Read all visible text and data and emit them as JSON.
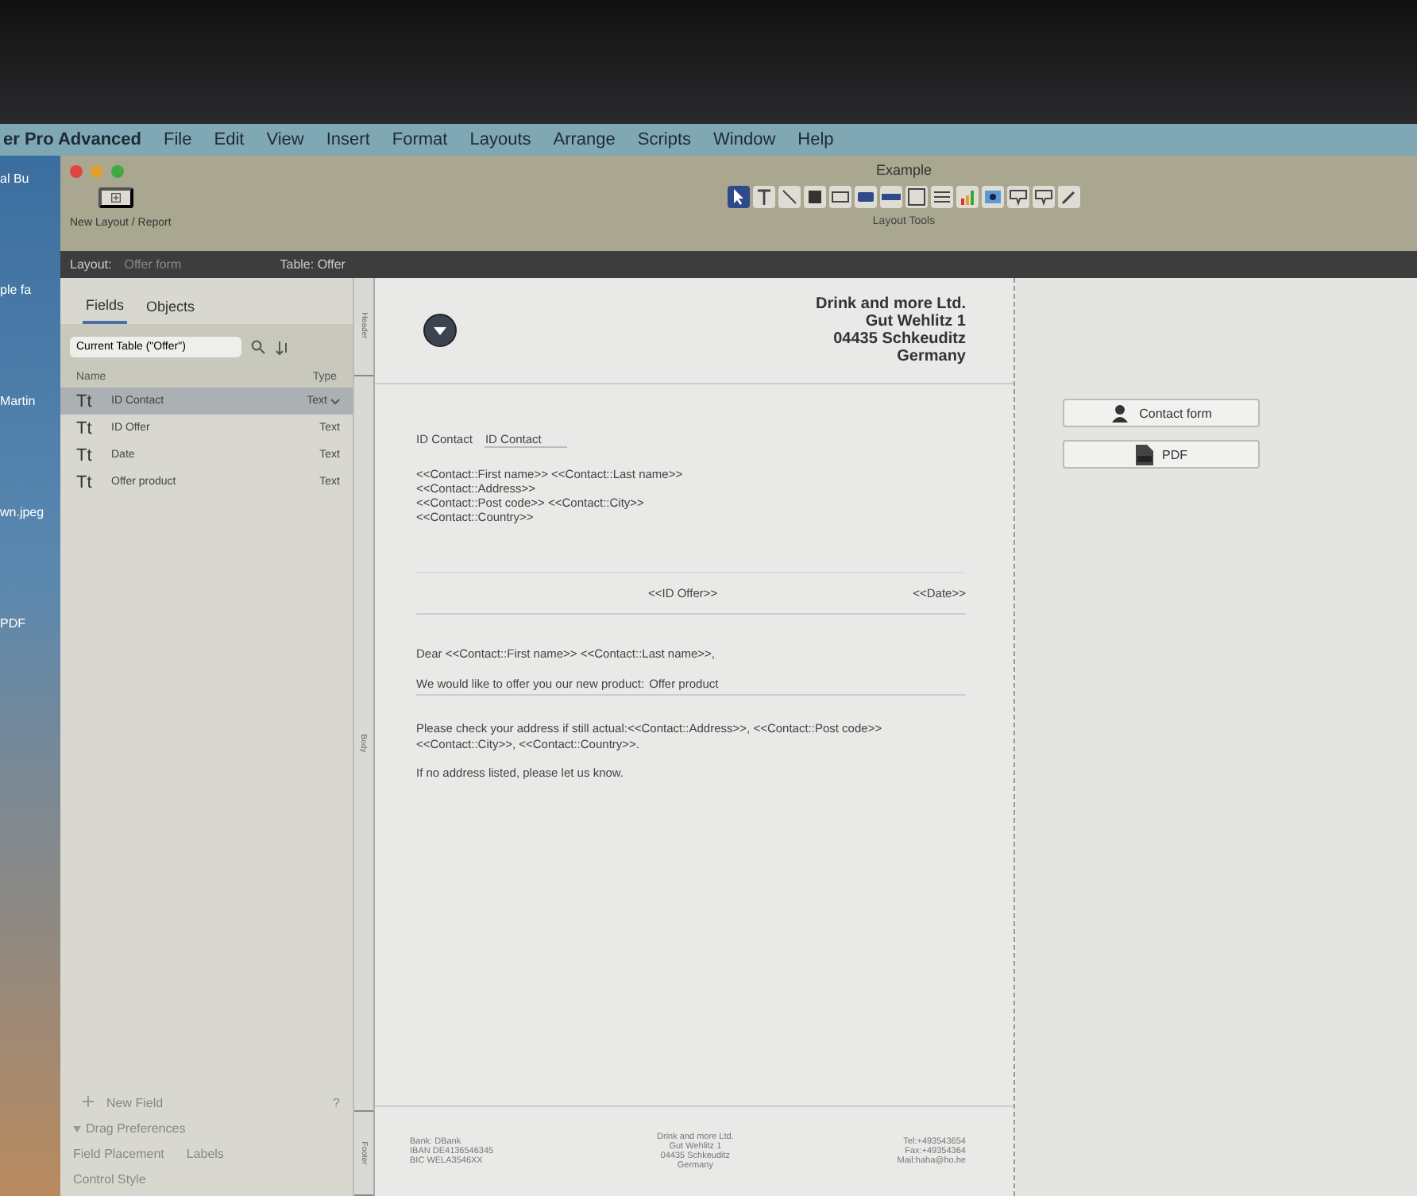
{
  "menu_bar": {
    "app_name": "er Pro Advanced",
    "items": [
      "File",
      "Edit",
      "View",
      "Insert",
      "Format",
      "Layouts",
      "Arrange",
      "Scripts",
      "Window",
      "Help"
    ]
  },
  "desktop": {
    "labels": [
      "al Bu",
      "ple fa",
      "Martin",
      "wn.jpeg",
      "PDF"
    ]
  },
  "window": {
    "title": "Example",
    "new_layout_label": "New Layout / Report",
    "tools_label": "Layout Tools",
    "tools": [
      {
        "kind": "pointer",
        "selected": true
      },
      {
        "kind": "text",
        "selected": false
      },
      {
        "kind": "line",
        "selected": false
      },
      {
        "kind": "shape",
        "selected": false
      },
      {
        "kind": "field",
        "selected": false
      },
      {
        "kind": "button",
        "selected": false
      },
      {
        "kind": "buttonbar",
        "selected": false
      },
      {
        "kind": "portal",
        "selected": false
      },
      {
        "kind": "list",
        "selected": false
      },
      {
        "kind": "chart",
        "selected": false
      },
      {
        "kind": "web",
        "selected": false
      },
      {
        "kind": "popover",
        "selected": false
      },
      {
        "kind": "popover",
        "selected": false
      },
      {
        "kind": "eyedropper",
        "selected": false
      }
    ]
  },
  "layout_bar": {
    "layout_label": "Layout:",
    "layout_value": "Offer form",
    "table": "Table: Offer"
  },
  "left_panel": {
    "tabs": [
      {
        "label": "Fields",
        "selected": true
      },
      {
        "label": "Objects",
        "selected": false
      }
    ],
    "table_select": "Current Table (\"Offer\")",
    "columns": [
      "Name",
      "Type"
    ],
    "fields": [
      {
        "icon": "Tt",
        "name": "ID Contact",
        "type": "Text",
        "selected": true
      },
      {
        "icon": "Tt",
        "name": "ID Offer",
        "type": "Text",
        "selected": false
      },
      {
        "icon": "Tt",
        "name": "Date",
        "type": "Text",
        "selected": false
      },
      {
        "icon": "Tt",
        "name": "Offer product",
        "type": "Text",
        "selected": false
      }
    ],
    "new_field": "New Field",
    "help": "?",
    "drag_preferences": "Drag Preferences",
    "field_placement": "Field Placement",
    "labels": "Labels",
    "control_style": "Control Style"
  },
  "parts": [
    "Header",
    "Body",
    "Footer"
  ],
  "page": {
    "company": [
      "Drink and more Ltd.",
      "Gut Wehlitz 1",
      "04435 Schkeuditz",
      "Germany"
    ],
    "id_label": "ID Contact",
    "id_field": "ID Contact",
    "address": [
      "<<Contact::First name>> <<Contact::Last name>>",
      "<<Contact::Address>>",
      "<<Contact::Post code>> <<Contact::City>>",
      "<<Contact::Country>>"
    ],
    "offer_id": "<<ID Offer>>",
    "date": "<<Date>>",
    "greeting": "Dear <<Contact::First name>> <<Contact::Last name>>,",
    "offer_text": "We would like to offer you our new product:",
    "offer_field": "Offer product",
    "check_text": "Please check your address if still actual:<<Contact::Address>>, <<Contact::Post code>> <<Contact::City>>, <<Contact::Country>>.",
    "closing": "If no address listed, please let us know.",
    "footer_left": [
      "Bank: DBank",
      "IBAN DE4136546345",
      "BIC WELA3546XX"
    ],
    "footer_center": [
      "Drink and more Ltd.",
      "Gut Wehlitz 1",
      "04435 Schkeuditz",
      "Germany"
    ],
    "footer_right": [
      "Tel:+493543654",
      "Fax:+49354364",
      "Mail:haha@ho.he"
    ]
  },
  "side_buttons": [
    {
      "kind": "contact",
      "label": "Contact form"
    },
    {
      "kind": "pdf",
      "label": "PDF"
    }
  ]
}
